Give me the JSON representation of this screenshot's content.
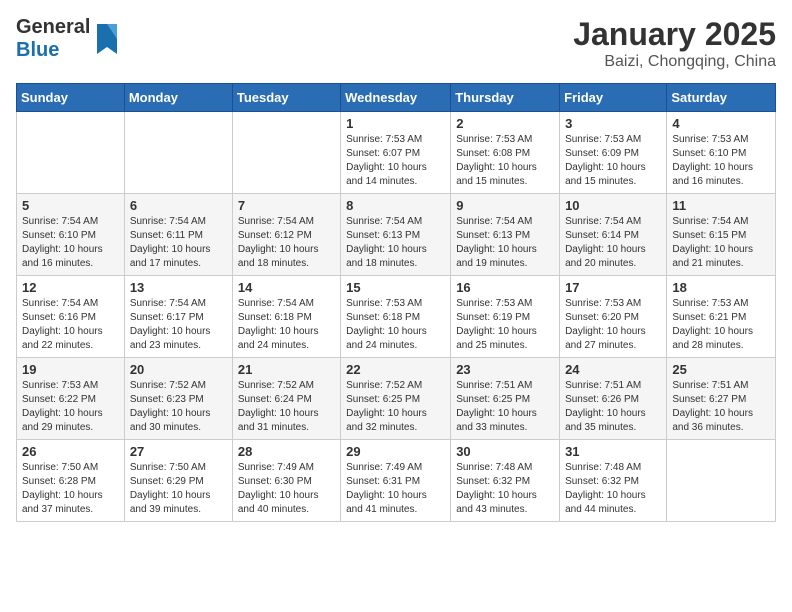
{
  "header": {
    "logo_general": "General",
    "logo_blue": "Blue",
    "month": "January 2025",
    "location": "Baizi, Chongqing, China"
  },
  "weekdays": [
    "Sunday",
    "Monday",
    "Tuesday",
    "Wednesday",
    "Thursday",
    "Friday",
    "Saturday"
  ],
  "weeks": [
    [
      {
        "day": "",
        "info": ""
      },
      {
        "day": "",
        "info": ""
      },
      {
        "day": "",
        "info": ""
      },
      {
        "day": "1",
        "info": "Sunrise: 7:53 AM\nSunset: 6:07 PM\nDaylight: 10 hours and 14 minutes."
      },
      {
        "day": "2",
        "info": "Sunrise: 7:53 AM\nSunset: 6:08 PM\nDaylight: 10 hours and 15 minutes."
      },
      {
        "day": "3",
        "info": "Sunrise: 7:53 AM\nSunset: 6:09 PM\nDaylight: 10 hours and 15 minutes."
      },
      {
        "day": "4",
        "info": "Sunrise: 7:53 AM\nSunset: 6:10 PM\nDaylight: 10 hours and 16 minutes."
      }
    ],
    [
      {
        "day": "5",
        "info": "Sunrise: 7:54 AM\nSunset: 6:10 PM\nDaylight: 10 hours and 16 minutes."
      },
      {
        "day": "6",
        "info": "Sunrise: 7:54 AM\nSunset: 6:11 PM\nDaylight: 10 hours and 17 minutes."
      },
      {
        "day": "7",
        "info": "Sunrise: 7:54 AM\nSunset: 6:12 PM\nDaylight: 10 hours and 18 minutes."
      },
      {
        "day": "8",
        "info": "Sunrise: 7:54 AM\nSunset: 6:13 PM\nDaylight: 10 hours and 18 minutes."
      },
      {
        "day": "9",
        "info": "Sunrise: 7:54 AM\nSunset: 6:13 PM\nDaylight: 10 hours and 19 minutes."
      },
      {
        "day": "10",
        "info": "Sunrise: 7:54 AM\nSunset: 6:14 PM\nDaylight: 10 hours and 20 minutes."
      },
      {
        "day": "11",
        "info": "Sunrise: 7:54 AM\nSunset: 6:15 PM\nDaylight: 10 hours and 21 minutes."
      }
    ],
    [
      {
        "day": "12",
        "info": "Sunrise: 7:54 AM\nSunset: 6:16 PM\nDaylight: 10 hours and 22 minutes."
      },
      {
        "day": "13",
        "info": "Sunrise: 7:54 AM\nSunset: 6:17 PM\nDaylight: 10 hours and 23 minutes."
      },
      {
        "day": "14",
        "info": "Sunrise: 7:54 AM\nSunset: 6:18 PM\nDaylight: 10 hours and 24 minutes."
      },
      {
        "day": "15",
        "info": "Sunrise: 7:53 AM\nSunset: 6:18 PM\nDaylight: 10 hours and 24 minutes."
      },
      {
        "day": "16",
        "info": "Sunrise: 7:53 AM\nSunset: 6:19 PM\nDaylight: 10 hours and 25 minutes."
      },
      {
        "day": "17",
        "info": "Sunrise: 7:53 AM\nSunset: 6:20 PM\nDaylight: 10 hours and 27 minutes."
      },
      {
        "day": "18",
        "info": "Sunrise: 7:53 AM\nSunset: 6:21 PM\nDaylight: 10 hours and 28 minutes."
      }
    ],
    [
      {
        "day": "19",
        "info": "Sunrise: 7:53 AM\nSunset: 6:22 PM\nDaylight: 10 hours and 29 minutes."
      },
      {
        "day": "20",
        "info": "Sunrise: 7:52 AM\nSunset: 6:23 PM\nDaylight: 10 hours and 30 minutes."
      },
      {
        "day": "21",
        "info": "Sunrise: 7:52 AM\nSunset: 6:24 PM\nDaylight: 10 hours and 31 minutes."
      },
      {
        "day": "22",
        "info": "Sunrise: 7:52 AM\nSunset: 6:25 PM\nDaylight: 10 hours and 32 minutes."
      },
      {
        "day": "23",
        "info": "Sunrise: 7:51 AM\nSunset: 6:25 PM\nDaylight: 10 hours and 33 minutes."
      },
      {
        "day": "24",
        "info": "Sunrise: 7:51 AM\nSunset: 6:26 PM\nDaylight: 10 hours and 35 minutes."
      },
      {
        "day": "25",
        "info": "Sunrise: 7:51 AM\nSunset: 6:27 PM\nDaylight: 10 hours and 36 minutes."
      }
    ],
    [
      {
        "day": "26",
        "info": "Sunrise: 7:50 AM\nSunset: 6:28 PM\nDaylight: 10 hours and 37 minutes."
      },
      {
        "day": "27",
        "info": "Sunrise: 7:50 AM\nSunset: 6:29 PM\nDaylight: 10 hours and 39 minutes."
      },
      {
        "day": "28",
        "info": "Sunrise: 7:49 AM\nSunset: 6:30 PM\nDaylight: 10 hours and 40 minutes."
      },
      {
        "day": "29",
        "info": "Sunrise: 7:49 AM\nSunset: 6:31 PM\nDaylight: 10 hours and 41 minutes."
      },
      {
        "day": "30",
        "info": "Sunrise: 7:48 AM\nSunset: 6:32 PM\nDaylight: 10 hours and 43 minutes."
      },
      {
        "day": "31",
        "info": "Sunrise: 7:48 AM\nSunset: 6:32 PM\nDaylight: 10 hours and 44 minutes."
      },
      {
        "day": "",
        "info": ""
      }
    ]
  ]
}
